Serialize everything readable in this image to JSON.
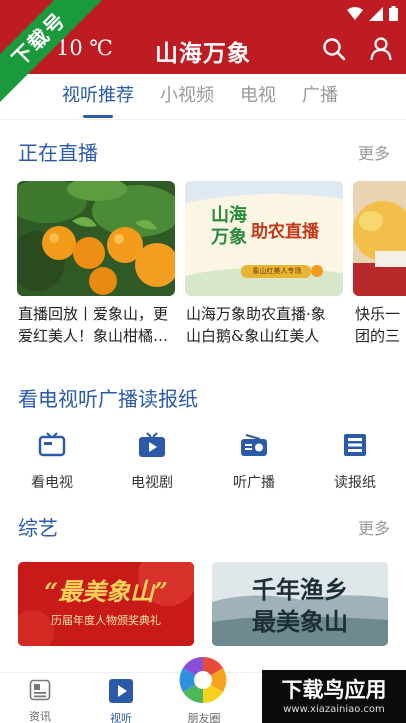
{
  "header": {
    "temperature": "10 ℃",
    "title": "山海万象",
    "ribbon": "下载号"
  },
  "tabs": [
    {
      "label": "视听推荐",
      "active": true
    },
    {
      "label": "小视频",
      "active": false
    },
    {
      "label": "电视",
      "active": false
    },
    {
      "label": "广播",
      "active": false
    }
  ],
  "live": {
    "title": "正在直播",
    "more": "更多",
    "items": [
      {
        "line1": "直播回放丨爱象山，更",
        "line2": "爱红美人！象山柑橘…"
      },
      {
        "line1": "山海万象助农直播·象",
        "line2": "山白鹅&象山红美人"
      },
      {
        "line1": "快乐一",
        "line2": "团的三"
      }
    ],
    "poster": {
      "line1": "山海",
      "line2": "万象",
      "tag": "助农直播",
      "sub": "象山红美人专场"
    }
  },
  "media": {
    "title": "看电视听广播读报纸",
    "items": [
      {
        "label": "看电视",
        "icon": "tv-icon"
      },
      {
        "label": "电视剧",
        "icon": "play-tv-icon"
      },
      {
        "label": "听广播",
        "icon": "radio-icon"
      },
      {
        "label": "读报纸",
        "icon": "newspaper-icon"
      }
    ]
  },
  "variety": {
    "title": "综艺",
    "more": "更多",
    "banners": [
      {
        "title": "“最美象山”",
        "subtitle": "历届年度人物颁奖典礼"
      },
      {
        "title": "千年渔乡",
        "subtitle": "最美象山"
      }
    ]
  },
  "tabbar": {
    "items": [
      {
        "label": "资讯",
        "icon": "news-icon",
        "active": false
      },
      {
        "label": "视听",
        "icon": "play-icon",
        "active": true
      },
      {
        "label": "朋友圈",
        "icon": "camera-aperture-icon",
        "active": false
      }
    ]
  },
  "watermark": {
    "line1": "下载鸟应用",
    "line2": "www.xiazainiao.com"
  },
  "colors": {
    "brand_red": "#bf1b22",
    "accent_blue": "#2a5aa8",
    "ribbon_green": "#1a9a3c"
  }
}
